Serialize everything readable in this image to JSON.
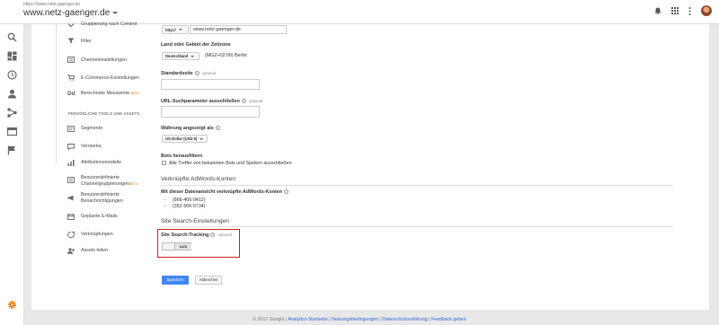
{
  "header": {
    "url": "https://www.netz-gaenger.de",
    "property": "www.netz-gaenger.de"
  },
  "leftnav": {
    "items": [
      {
        "label": "Gruppierung nach Content"
      },
      {
        "label": "Filter"
      },
      {
        "label": "Channeleinstellungen"
      },
      {
        "label": "E-Commerce-Einstellungen"
      },
      {
        "label": "Berechnete Messwerte",
        "badge": "BETA"
      }
    ],
    "tools_header": "PERSÖNLICHE TOOLS UND ASSETS",
    "tools": [
      {
        "label": "Segmente"
      },
      {
        "label": "Vermerke"
      },
      {
        "label": "Attributionsmodelle"
      },
      {
        "label": "Benutzerdefinierte Channelgruppierungen",
        "badge": "BETA"
      },
      {
        "label": "Benutzerdefinierte Benachrichtigungen"
      },
      {
        "label": "Geplante E-Mails"
      },
      {
        "label": "Verknüpfungen"
      },
      {
        "label": "Assets teilen"
      }
    ]
  },
  "form": {
    "url_protocol": "http://",
    "url_value": "www.netz-gaenger.de",
    "country_label": "Land oder Gebiet der Zeitzone",
    "country_value": "Deutschland",
    "timezone": "(MGZ+02:00) Berlin",
    "default_page_label": "Standardseite",
    "optional": "optional",
    "exclude_params_label": "URL-Suchparameter ausschließen",
    "currency_label": "Währung angezeigt als",
    "currency_value": "US-Dollar (USD $)",
    "bot_label": "Bots herausfiltern",
    "bot_checkbox": "Alle Treffer von bekannten Bots und Spidern ausschließen",
    "adwords_section": "Verknüpfte AdWords-Konten",
    "adwords_label": "Mit dieser Datenansicht verknüpfte AdWords-Konten",
    "adwords_accounts": [
      "(866-406-9412)",
      "(352-506-5734)"
    ],
    "site_search_section": "Site Search-Einstellungen",
    "site_search_label": "Site Search-Tracking",
    "toggle_state": "AUS",
    "save": "Speichern",
    "cancel": "Abbrechen"
  },
  "footer": {
    "copyright": "© 2017 Google |",
    "link1": "Analytics-Startseite",
    "link2": "Nutzungsbedingungen",
    "link3": "Datenschutzerklärung",
    "link4": "Feedback geben",
    "sep": "|"
  }
}
